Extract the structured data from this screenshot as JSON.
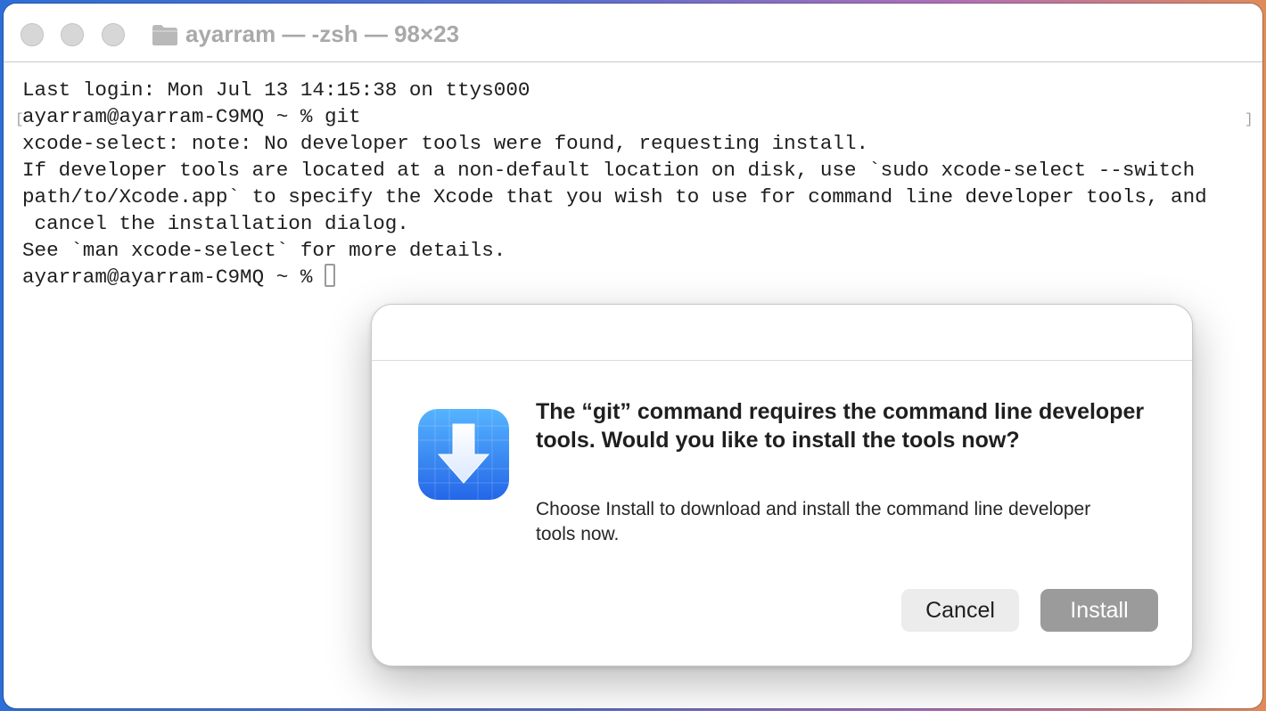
{
  "window": {
    "title": "ayarram — -zsh — 98×23"
  },
  "terminal": {
    "lines": [
      "Last login: Mon Jul 13 14:15:38 on ttys000",
      "ayarram@ayarram-C9MQ ~ % git",
      "xcode-select: note: No developer tools were found, requesting install.",
      "If developer tools are located at a non-default location on disk, use `sudo xcode-select --switch",
      "path/to/Xcode.app` to specify the Xcode that you wish to use for command line developer tools, and",
      " cancel the installation dialog.",
      "See `man xcode-select` for more details."
    ],
    "prompt": "ayarram@ayarram-C9MQ ~ % "
  },
  "dialog": {
    "icon": "download-arrow-icon",
    "title": "The “git” command requires the command line developer tools. Would you like to install the tools now?",
    "body": "Choose Install to download and install the command line developer tools now.",
    "cancel_label": "Cancel",
    "install_label": "Install"
  },
  "colors": {
    "install_button": "#9b9b9b",
    "cancel_button": "#ececec",
    "icon_blue": "#2f7cf0"
  }
}
